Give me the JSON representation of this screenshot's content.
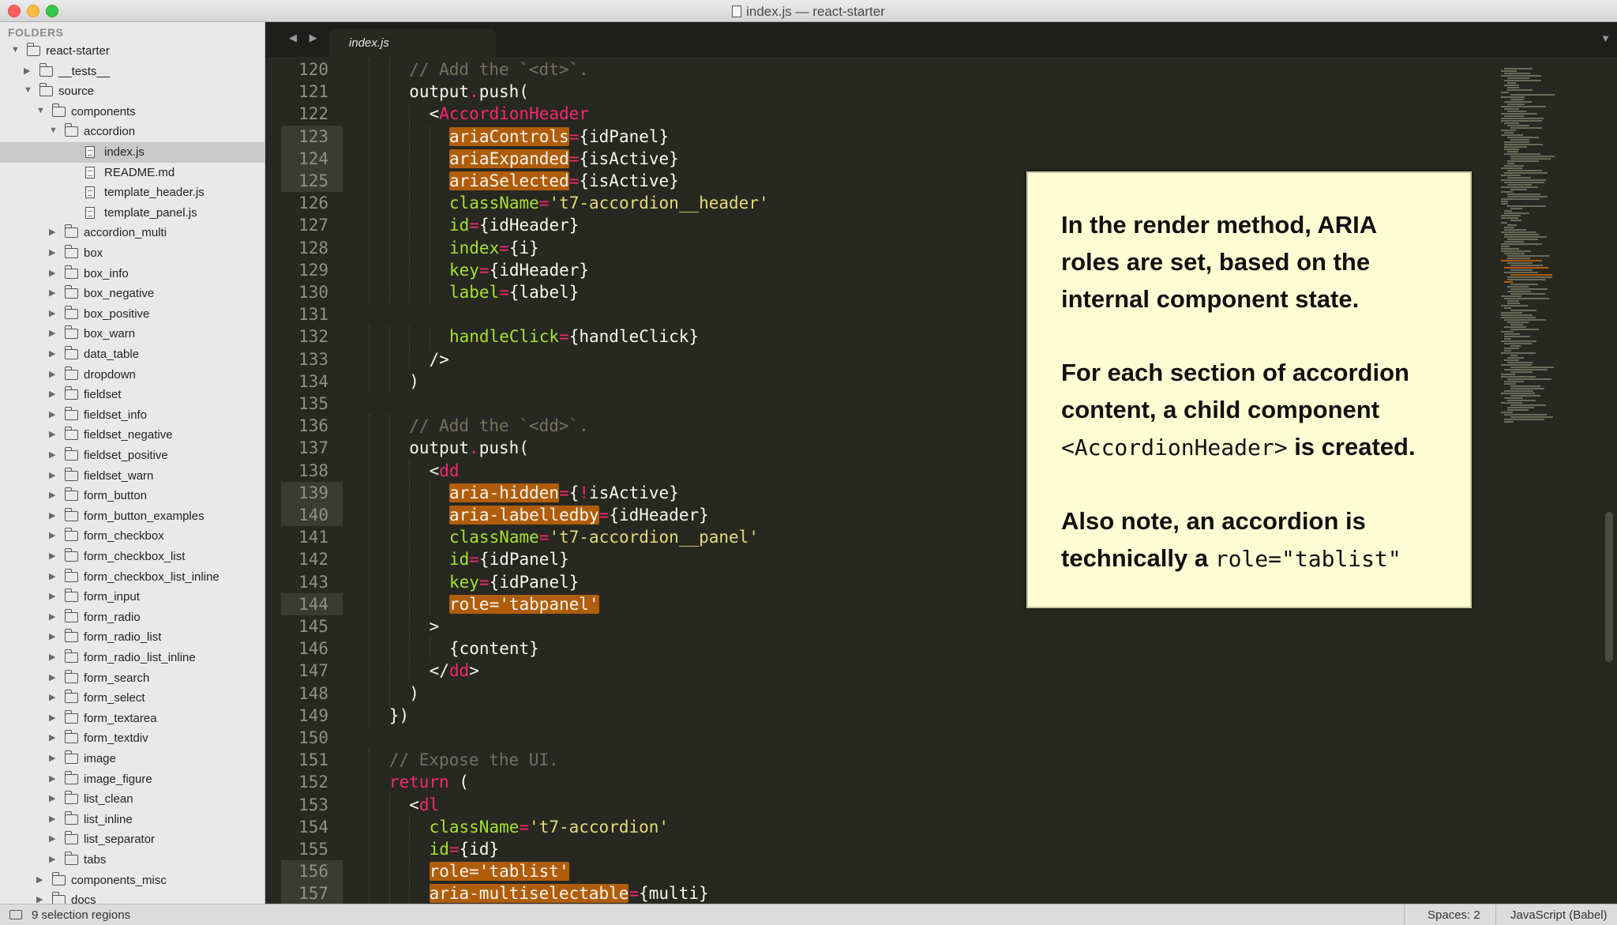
{
  "window": {
    "title": "index.js — react-starter"
  },
  "sidebar": {
    "header": "FOLDERS",
    "tree": [
      {
        "label": "react-starter",
        "type": "folder",
        "depth": 0,
        "open": true
      },
      {
        "label": "__tests__",
        "type": "folder",
        "depth": 1,
        "open": false
      },
      {
        "label": "source",
        "type": "folder",
        "depth": 1,
        "open": true
      },
      {
        "label": "components",
        "type": "folder",
        "depth": 2,
        "open": true
      },
      {
        "label": "accordion",
        "type": "folder",
        "depth": 3,
        "open": true
      },
      {
        "label": "index.js",
        "type": "file",
        "depth": 4,
        "selected": true
      },
      {
        "label": "README.md",
        "type": "file",
        "depth": 4
      },
      {
        "label": "template_header.js",
        "type": "file",
        "depth": 4
      },
      {
        "label": "template_panel.js",
        "type": "file",
        "depth": 4
      },
      {
        "label": "accordion_multi",
        "type": "folder",
        "depth": 3,
        "open": false
      },
      {
        "label": "box",
        "type": "folder",
        "depth": 3,
        "open": false
      },
      {
        "label": "box_info",
        "type": "folder",
        "depth": 3,
        "open": false
      },
      {
        "label": "box_negative",
        "type": "folder",
        "depth": 3,
        "open": false
      },
      {
        "label": "box_positive",
        "type": "folder",
        "depth": 3,
        "open": false
      },
      {
        "label": "box_warn",
        "type": "folder",
        "depth": 3,
        "open": false
      },
      {
        "label": "data_table",
        "type": "folder",
        "depth": 3,
        "open": false
      },
      {
        "label": "dropdown",
        "type": "folder",
        "depth": 3,
        "open": false
      },
      {
        "label": "fieldset",
        "type": "folder",
        "depth": 3,
        "open": false
      },
      {
        "label": "fieldset_info",
        "type": "folder",
        "depth": 3,
        "open": false
      },
      {
        "label": "fieldset_negative",
        "type": "folder",
        "depth": 3,
        "open": false
      },
      {
        "label": "fieldset_positive",
        "type": "folder",
        "depth": 3,
        "open": false
      },
      {
        "label": "fieldset_warn",
        "type": "folder",
        "depth": 3,
        "open": false
      },
      {
        "label": "form_button",
        "type": "folder",
        "depth": 3,
        "open": false
      },
      {
        "label": "form_button_examples",
        "type": "folder",
        "depth": 3,
        "open": false
      },
      {
        "label": "form_checkbox",
        "type": "folder",
        "depth": 3,
        "open": false
      },
      {
        "label": "form_checkbox_list",
        "type": "folder",
        "depth": 3,
        "open": false
      },
      {
        "label": "form_checkbox_list_inline",
        "type": "folder",
        "depth": 3,
        "open": false
      },
      {
        "label": "form_input",
        "type": "folder",
        "depth": 3,
        "open": false
      },
      {
        "label": "form_radio",
        "type": "folder",
        "depth": 3,
        "open": false
      },
      {
        "label": "form_radio_list",
        "type": "folder",
        "depth": 3,
        "open": false
      },
      {
        "label": "form_radio_list_inline",
        "type": "folder",
        "depth": 3,
        "open": false
      },
      {
        "label": "form_search",
        "type": "folder",
        "depth": 3,
        "open": false
      },
      {
        "label": "form_select",
        "type": "folder",
        "depth": 3,
        "open": false
      },
      {
        "label": "form_textarea",
        "type": "folder",
        "depth": 3,
        "open": false
      },
      {
        "label": "form_textdiv",
        "type": "folder",
        "depth": 3,
        "open": false
      },
      {
        "label": "image",
        "type": "folder",
        "depth": 3,
        "open": false
      },
      {
        "label": "image_figure",
        "type": "folder",
        "depth": 3,
        "open": false
      },
      {
        "label": "list_clean",
        "type": "folder",
        "depth": 3,
        "open": false
      },
      {
        "label": "list_inline",
        "type": "folder",
        "depth": 3,
        "open": false
      },
      {
        "label": "list_separator",
        "type": "folder",
        "depth": 3,
        "open": false
      },
      {
        "label": "tabs",
        "type": "folder",
        "depth": 3,
        "open": false
      },
      {
        "label": "components_misc",
        "type": "folder",
        "depth": 2,
        "open": false
      },
      {
        "label": "docs",
        "type": "folder",
        "depth": 2,
        "open": false
      }
    ]
  },
  "tabs": {
    "nav": "◀ ▶",
    "active": "index.js",
    "dropdown": "▼"
  },
  "editor": {
    "lines": [
      {
        "n": 120,
        "indent": 3,
        "tokens": [
          [
            "com",
            "// Add the `<dt>`."
          ]
        ]
      },
      {
        "n": 121,
        "indent": 3,
        "tokens": [
          [
            "pl",
            "output"
          ],
          [
            "op",
            "."
          ],
          [
            "pl",
            "push("
          ]
        ]
      },
      {
        "n": 122,
        "indent": 4,
        "tokens": [
          [
            "pl",
            "<"
          ],
          [
            "tag",
            "AccordionHeader"
          ]
        ]
      },
      {
        "n": 123,
        "indent": 5,
        "marked": true,
        "tokens": [
          [
            "sel",
            "ariaControls"
          ],
          [
            "op",
            "="
          ],
          [
            "pl",
            "{idPanel}"
          ]
        ]
      },
      {
        "n": 124,
        "indent": 5,
        "marked": true,
        "tokens": [
          [
            "sel",
            "ariaExpanded"
          ],
          [
            "op",
            "="
          ],
          [
            "pl",
            "{isActive}"
          ]
        ]
      },
      {
        "n": 125,
        "indent": 5,
        "marked": true,
        "tokens": [
          [
            "sel",
            "ariaSelected"
          ],
          [
            "op",
            "="
          ],
          [
            "pl",
            "{isActive}"
          ]
        ]
      },
      {
        "n": 126,
        "indent": 5,
        "tokens": [
          [
            "attr",
            "className"
          ],
          [
            "op",
            "="
          ],
          [
            "str",
            "'t7-accordion__header'"
          ]
        ]
      },
      {
        "n": 127,
        "indent": 5,
        "tokens": [
          [
            "attr",
            "id"
          ],
          [
            "op",
            "="
          ],
          [
            "pl",
            "{idHeader}"
          ]
        ]
      },
      {
        "n": 128,
        "indent": 5,
        "tokens": [
          [
            "attr",
            "index"
          ],
          [
            "op",
            "="
          ],
          [
            "pl",
            "{i}"
          ]
        ]
      },
      {
        "n": 129,
        "indent": 5,
        "tokens": [
          [
            "attr",
            "key"
          ],
          [
            "op",
            "="
          ],
          [
            "pl",
            "{idHeader}"
          ]
        ]
      },
      {
        "n": 130,
        "indent": 5,
        "tokens": [
          [
            "attr",
            "label"
          ],
          [
            "op",
            "="
          ],
          [
            "pl",
            "{label}"
          ]
        ]
      },
      {
        "n": 131,
        "indent": 0,
        "tokens": []
      },
      {
        "n": 132,
        "indent": 5,
        "tokens": [
          [
            "attr",
            "handleClick"
          ],
          [
            "op",
            "="
          ],
          [
            "pl",
            "{handleClick}"
          ]
        ]
      },
      {
        "n": 133,
        "indent": 4,
        "tokens": [
          [
            "pl",
            "/>"
          ]
        ]
      },
      {
        "n": 134,
        "indent": 3,
        "tokens": [
          [
            "pl",
            ")"
          ]
        ]
      },
      {
        "n": 135,
        "indent": 0,
        "tokens": []
      },
      {
        "n": 136,
        "indent": 3,
        "tokens": [
          [
            "com",
            "// Add the `<dd>`."
          ]
        ]
      },
      {
        "n": 137,
        "indent": 3,
        "tokens": [
          [
            "pl",
            "output"
          ],
          [
            "op",
            "."
          ],
          [
            "pl",
            "push("
          ]
        ]
      },
      {
        "n": 138,
        "indent": 4,
        "tokens": [
          [
            "pl",
            "<"
          ],
          [
            "tag",
            "dd"
          ]
        ]
      },
      {
        "n": 139,
        "indent": 5,
        "marked": true,
        "tokens": [
          [
            "sel",
            "aria-hidden"
          ],
          [
            "op",
            "="
          ],
          [
            "pl",
            "{"
          ],
          [
            "op",
            "!"
          ],
          [
            "pl",
            "isActive}"
          ]
        ]
      },
      {
        "n": 140,
        "indent": 5,
        "marked": true,
        "tokens": [
          [
            "sel",
            "aria-labelledby"
          ],
          [
            "op",
            "="
          ],
          [
            "pl",
            "{idHeader}"
          ]
        ]
      },
      {
        "n": 141,
        "indent": 5,
        "tokens": [
          [
            "attr",
            "className"
          ],
          [
            "op",
            "="
          ],
          [
            "str",
            "'t7-accordion__panel'"
          ]
        ]
      },
      {
        "n": 142,
        "indent": 5,
        "tokens": [
          [
            "attr",
            "id"
          ],
          [
            "op",
            "="
          ],
          [
            "pl",
            "{idPanel}"
          ]
        ]
      },
      {
        "n": 143,
        "indent": 5,
        "tokens": [
          [
            "attr",
            "key"
          ],
          [
            "op",
            "="
          ],
          [
            "pl",
            "{idPanel}"
          ]
        ]
      },
      {
        "n": 144,
        "indent": 5,
        "marked": true,
        "tokens": [
          [
            "sel",
            "role='tabpanel'"
          ]
        ]
      },
      {
        "n": 145,
        "indent": 4,
        "tokens": [
          [
            "pl",
            ">"
          ]
        ]
      },
      {
        "n": 146,
        "indent": 5,
        "tokens": [
          [
            "pl",
            "{content}"
          ]
        ]
      },
      {
        "n": 147,
        "indent": 4,
        "tokens": [
          [
            "pl",
            "</"
          ],
          [
            "tag",
            "dd"
          ],
          [
            "pl",
            ">"
          ]
        ]
      },
      {
        "n": 148,
        "indent": 3,
        "tokens": [
          [
            "pl",
            ")"
          ]
        ]
      },
      {
        "n": 149,
        "indent": 2,
        "tokens": [
          [
            "pl",
            "})"
          ]
        ]
      },
      {
        "n": 150,
        "indent": 0,
        "tokens": []
      },
      {
        "n": 151,
        "indent": 2,
        "tokens": [
          [
            "com",
            "// Expose the UI."
          ]
        ]
      },
      {
        "n": 152,
        "indent": 2,
        "tokens": [
          [
            "kw",
            "return"
          ],
          [
            "pl",
            " ("
          ]
        ]
      },
      {
        "n": 153,
        "indent": 3,
        "tokens": [
          [
            "pl",
            "<"
          ],
          [
            "tag",
            "dl"
          ]
        ]
      },
      {
        "n": 154,
        "indent": 4,
        "tokens": [
          [
            "attr",
            "className"
          ],
          [
            "op",
            "="
          ],
          [
            "str",
            "'t7-accordion'"
          ]
        ]
      },
      {
        "n": 155,
        "indent": 4,
        "tokens": [
          [
            "attr",
            "id"
          ],
          [
            "op",
            "="
          ],
          [
            "pl",
            "{id}"
          ]
        ]
      },
      {
        "n": 156,
        "indent": 4,
        "marked": true,
        "tokens": [
          [
            "sel",
            "role='tablist'"
          ]
        ]
      },
      {
        "n": 157,
        "indent": 4,
        "marked": true,
        "tokens": [
          [
            "sel",
            "aria-multiselectable"
          ],
          [
            "op",
            "="
          ],
          [
            "pl",
            "{multi}"
          ]
        ]
      }
    ]
  },
  "callout": {
    "p1": "In the render method, ARIA roles are set, based on the internal component state.",
    "p2_a": "For each section of accordion content, a child component ",
    "p2_code": "<AccordionHeader>",
    "p2_b": " is created.",
    "p3_a": "Also note, an accordion is technically a ",
    "p3_code": "role=\"tablist\""
  },
  "statusbar": {
    "selection": "9 selection regions",
    "spaces": "Spaces: 2",
    "syntax": "JavaScript (Babel)"
  }
}
